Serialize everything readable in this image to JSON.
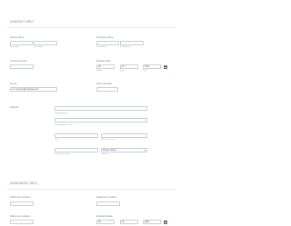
{
  "contact": {
    "title": "CONTACT INFO",
    "patient_name": {
      "label": "Patient Name",
      "first_label": "First Name",
      "last_label": "Last Name",
      "first_value": "",
      "last_value": ""
    },
    "physician_name": {
      "label": "Physician Name",
      "first_label": "First Name",
      "last_label": "Last Name",
      "first_value": "",
      "last_value": ""
    },
    "contact_number": {
      "label": "Contact Number",
      "value": ""
    },
    "birthday_date": {
      "label": "Birthday Date",
      "month_value": "05",
      "day_value": "10",
      "year_value": "2021",
      "month_label": "Month",
      "day_label": "Day",
      "year_label": "Year"
    },
    "email": {
      "label": "E-mail",
      "value": "ex: myname@example.com"
    },
    "phone": {
      "label": "Phone Number",
      "value": ""
    },
    "address": {
      "label": "Address",
      "street_label": "Street Address",
      "street2_label": "Street Address Line 2",
      "city_label": "City",
      "state_label": "State / Province",
      "zip_label": "Postal / Zip Code",
      "country_label": "Country",
      "country_value": "Please Select"
    }
  },
  "insurance": {
    "title": "INSURANCE INFO",
    "ref_loc_1": {
      "label": "Reference Location",
      "value": ""
    },
    "ref_loc_2": {
      "label": "Reference Location",
      "value": ""
    },
    "ref_loc_3": {
      "label": "Reference Location",
      "value": ""
    },
    "expiration": {
      "label": "Expiration Date",
      "month_value": "05",
      "day_value": "10",
      "year_value": "2021"
    }
  }
}
